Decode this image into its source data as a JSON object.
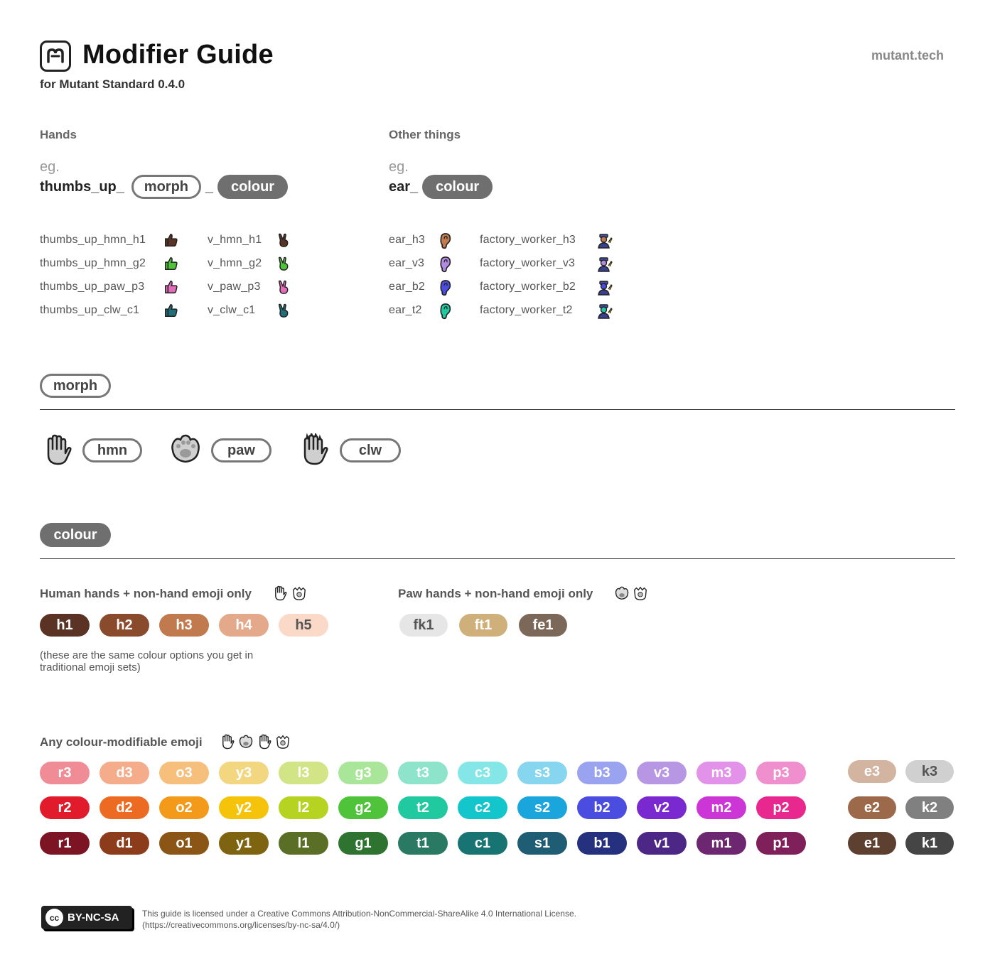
{
  "header": {
    "title": "Modifier Guide",
    "subtitle": "for Mutant Standard 0.4.0",
    "site": "mutant.tech"
  },
  "hands": {
    "label": "Hands",
    "eg": "eg.",
    "example_word": "thumbs_up_",
    "separator": "_",
    "morph_pill": "morph",
    "colour_pill": "colour",
    "col1": [
      {
        "text": "thumbs_up_hmn_h1",
        "color": "#5b3324"
      },
      {
        "text": "thumbs_up_hmn_g2",
        "color": "#4fc43b"
      },
      {
        "text": "thumbs_up_paw_p3",
        "color": "#e46dbb"
      },
      {
        "text": "thumbs_up_clw_c1",
        "color": "#1f6e78"
      }
    ],
    "col2": [
      {
        "text": "v_hmn_h1",
        "color": "#5b3324"
      },
      {
        "text": "v_hmn_g2",
        "color": "#4fc43b"
      },
      {
        "text": "v_paw_p3",
        "color": "#e46dbb"
      },
      {
        "text": "v_clw_c1",
        "color": "#1f6e78"
      }
    ]
  },
  "other": {
    "label": "Other things",
    "eg": "eg.",
    "example_word": "ear_",
    "colour_pill": "colour",
    "col1": [
      {
        "text": "ear_h3",
        "color": "#c07a4e"
      },
      {
        "text": "ear_v3",
        "color": "#b08be0"
      },
      {
        "text": "ear_b2",
        "color": "#4a4de0"
      },
      {
        "text": "ear_t2",
        "color": "#21c9a0"
      }
    ],
    "col2": [
      {
        "text": "factory_worker_h3",
        "color": "#c07a4e"
      },
      {
        "text": "factory_worker_v3",
        "color": "#b08be0"
      },
      {
        "text": "factory_worker_b2",
        "color": "#4a4de0"
      },
      {
        "text": "factory_worker_t2",
        "color": "#21c9a0"
      }
    ]
  },
  "morph_section": {
    "heading": "morph",
    "items": [
      {
        "label": "hmn",
        "icon": "human-hand-icon"
      },
      {
        "label": "paw",
        "icon": "paw-icon"
      },
      {
        "label": "clw",
        "icon": "claw-icon"
      }
    ]
  },
  "colour_section": {
    "heading": "colour",
    "human_label": "Human hands + non-hand emoji only",
    "paw_label": "Paw hands + non-hand emoji only",
    "human": [
      {
        "label": "h1",
        "bg": "#5b3324",
        "fg": "#ffffff"
      },
      {
        "label": "h2",
        "bg": "#8a4a2c",
        "fg": "#ffffff"
      },
      {
        "label": "h3",
        "bg": "#c07a4e",
        "fg": "#ffffff"
      },
      {
        "label": "h4",
        "bg": "#e3a98a",
        "fg": "#ffffff"
      },
      {
        "label": "h5",
        "bg": "#fbd9c8",
        "fg": "#555555"
      }
    ],
    "paw": [
      {
        "label": "fk1",
        "bg": "#e6e6e6",
        "fg": "#555555"
      },
      {
        "label": "ft1",
        "bg": "#cfb07a",
        "fg": "#ffffff"
      },
      {
        "label": "fe1",
        "bg": "#7c6858",
        "fg": "#ffffff"
      }
    ],
    "note": "(these are the same colour options you get in traditional emoji sets)",
    "any_label": "Any colour-modifiable emoji",
    "grid": [
      [
        {
          "label": "r3",
          "bg": "#ef8c96"
        },
        {
          "label": "d3",
          "bg": "#f5ac8a"
        },
        {
          "label": "o3",
          "bg": "#f6c07c"
        },
        {
          "label": "y3",
          "bg": "#f2d680"
        },
        {
          "label": "l3",
          "bg": "#d2e586"
        },
        {
          "label": "g3",
          "bg": "#a9e69a"
        },
        {
          "label": "t3",
          "bg": "#8ee4cb"
        },
        {
          "label": "c3",
          "bg": "#84e6e6"
        },
        {
          "label": "s3",
          "bg": "#86d6ef"
        },
        {
          "label": "b3",
          "bg": "#9aa3f0"
        },
        {
          "label": "v3",
          "bg": "#b797e4"
        },
        {
          "label": "m3",
          "bg": "#e292e8"
        },
        {
          "label": "p3",
          "bg": "#f08fce"
        }
      ],
      [
        {
          "label": "r2",
          "bg": "#e11b2c"
        },
        {
          "label": "d2",
          "bg": "#ec6a21"
        },
        {
          "label": "o2",
          "bg": "#f39a1a"
        },
        {
          "label": "y2",
          "bg": "#f5c40a"
        },
        {
          "label": "l2",
          "bg": "#b5d320"
        },
        {
          "label": "g2",
          "bg": "#4fc43b"
        },
        {
          "label": "t2",
          "bg": "#21c9a0"
        },
        {
          "label": "c2",
          "bg": "#13c6cc"
        },
        {
          "label": "s2",
          "bg": "#1aa6dc"
        },
        {
          "label": "b2",
          "bg": "#4a4de0"
        },
        {
          "label": "v2",
          "bg": "#7a28cf"
        },
        {
          "label": "m2",
          "bg": "#cc36d6"
        },
        {
          "label": "p2",
          "bg": "#e8288e"
        }
      ],
      [
        {
          "label": "r1",
          "bg": "#7d1423"
        },
        {
          "label": "d1",
          "bg": "#8c3c1a"
        },
        {
          "label": "o1",
          "bg": "#8a5515"
        },
        {
          "label": "y1",
          "bg": "#7e6410"
        },
        {
          "label": "l1",
          "bg": "#5b6e25"
        },
        {
          "label": "g1",
          "bg": "#2e7330"
        },
        {
          "label": "t1",
          "bg": "#2a7a63"
        },
        {
          "label": "c1",
          "bg": "#177472"
        },
        {
          "label": "s1",
          "bg": "#1e5d73"
        },
        {
          "label": "b1",
          "bg": "#25307e"
        },
        {
          "label": "v1",
          "bg": "#4d2785"
        },
        {
          "label": "m1",
          "bg": "#6d2670"
        },
        {
          "label": "p1",
          "bg": "#80205a"
        }
      ]
    ],
    "neutral": [
      [
        {
          "label": "e3",
          "bg": "#d3b4a0"
        },
        {
          "label": "k3",
          "bg": "#d0d0d0",
          "fg": "#555555"
        }
      ],
      [
        {
          "label": "e2",
          "bg": "#9c6a4a"
        },
        {
          "label": "k2",
          "bg": "#808080"
        }
      ],
      [
        {
          "label": "e1",
          "bg": "#5e4030"
        },
        {
          "label": "k1",
          "bg": "#454545"
        }
      ]
    ]
  },
  "footer": {
    "badge": "BY-NC-SA",
    "cc": "cc",
    "license_line1": "This guide is licensed under a Creative Commons Attribution-NonCommercial-ShareAlike 4.0 International License.",
    "license_line2": "(https://creativecommons.org/licenses/by-nc-sa/4.0/)"
  }
}
